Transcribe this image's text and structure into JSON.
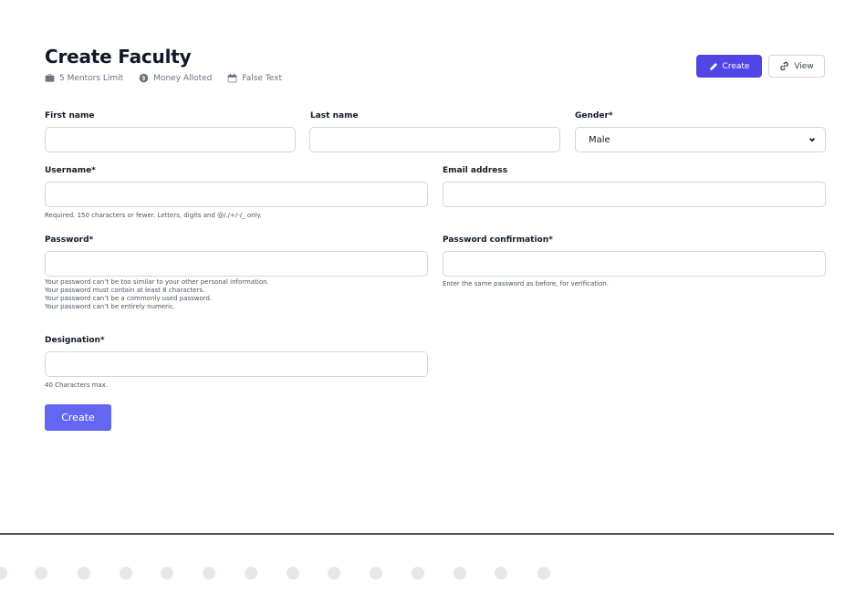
{
  "header": {
    "title": "Create Faculty",
    "meta": [
      {
        "label": "5 Mentors Limit",
        "icon": "briefcase-icon"
      },
      {
        "label": "Money Alloted",
        "icon": "dollar-icon"
      },
      {
        "label": "False Text",
        "icon": "calendar-icon"
      }
    ]
  },
  "actions": {
    "create_label": "Create",
    "view_label": "View"
  },
  "form": {
    "first_name": {
      "label": "First name",
      "value": ""
    },
    "last_name": {
      "label": "Last name",
      "value": ""
    },
    "gender": {
      "label": "Gender*",
      "value": "Male"
    },
    "username": {
      "label": "Username*",
      "value": "",
      "help": "Required. 150 characters or fewer. Letters, digits and @/./+/-/_ only."
    },
    "email": {
      "label": "Email address",
      "value": ""
    },
    "password": {
      "label": "Password*",
      "value": "",
      "help": [
        "Your password can’t be too similar to your other personal information.",
        "Your password must contain at least 8 characters.",
        "Your password can’t be a commonly used password.",
        "Your password can’t be entirely numeric."
      ]
    },
    "password_confirmation": {
      "label": "Password confirmation*",
      "value": "",
      "help": "Enter the same password as before, for verification."
    },
    "designation": {
      "label": "Designation*",
      "value": "",
      "help": "40 Characters max."
    },
    "submit_label": "Create"
  },
  "colors": {
    "accent": "#4f46e5",
    "submit": "#6366f1",
    "border": "#d1d5db"
  }
}
